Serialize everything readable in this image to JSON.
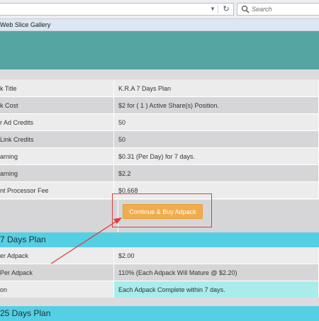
{
  "browser": {
    "search_placeholder": "Search",
    "url_dropdown_glyph": "▼",
    "refresh_glyph": "↻",
    "favorites": [
      "Web Slice Gallery"
    ]
  },
  "plan7": {
    "rows": [
      {
        "label": "k Title",
        "value": "K.R.A 7 Days Plan"
      },
      {
        "label": "k Cost",
        "value": "$2 for ( 1 ) Active Share(s) Position."
      },
      {
        "label": "r Ad Credits",
        "value": "50"
      },
      {
        "label": "Link Credits",
        "value": "50"
      },
      {
        "label": "arning",
        "value": "$0.31 (Per Day) for 7 days."
      },
      {
        "label": "arning",
        "value": "$2.2"
      },
      {
        "label": "nt Processor Fee",
        "value": "$0.668"
      }
    ],
    "button_label": "Continue & Buy Adpack"
  },
  "section_7": {
    "title": "7 Days Plan",
    "rows": [
      {
        "label": "er Adpack",
        "value": "$2.00"
      },
      {
        "label": "Per Adpack",
        "value": "110% (Each Adpack Will Mature @ $2.20)"
      },
      {
        "label": "on",
        "value": "Each Adpack Complete within 7 days."
      }
    ]
  },
  "section_25": {
    "title": "25 Days Plan"
  },
  "colors": {
    "banner": "#55a6a3",
    "section_header": "#55cfe3",
    "button": "#f0ad4e",
    "annotation": "#e23b3b",
    "highlight_cell": "#a8ecec"
  }
}
